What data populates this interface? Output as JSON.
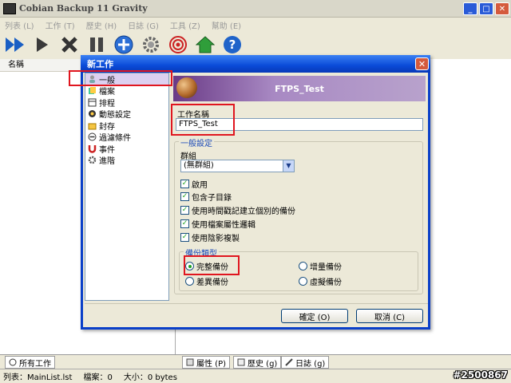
{
  "main_window": {
    "title": "Cobian Backup 11 Gravity",
    "menu": [
      "列表 (L)",
      "工作 (T)",
      "歷史 (H)",
      "日誌 (G)",
      "工具 (Z)",
      "幫助 (E)"
    ],
    "list_header": "名稱",
    "bottom_left_tab": "所有工作",
    "bottom_tabs": [
      "屬性 (P)",
      "歷史 (g)",
      "日誌 (g)"
    ],
    "status": {
      "list": "列表：MainList.lst",
      "tasks": "檔案：0",
      "size": "大小：0 bytes"
    },
    "watermark": "#2500867"
  },
  "dialog": {
    "title": "新工作",
    "nav_items": [
      "一般",
      "檔案",
      "排程",
      "動態設定",
      "封存",
      "過濾條件",
      "事件",
      "進階"
    ],
    "selected_nav": 0,
    "banner": "FTPS_Test",
    "task_name_label": "工作名稱",
    "task_name_value": "FTPS_Test",
    "general_group_title": "一般設定",
    "group_label": "群組",
    "group_value": "(無群組)",
    "checkboxes": [
      {
        "label": "啟用",
        "checked": true
      },
      {
        "label": "包含子目錄",
        "checked": true
      },
      {
        "label": "使用時間戳記建立個別的備份",
        "checked": true
      },
      {
        "label": "使用檔案屬性邏輯",
        "checked": true
      },
      {
        "label": "使用陰影複製",
        "checked": true
      }
    ],
    "backup_type_title": "備份類型",
    "backup_types": [
      "完整備份",
      "增量備份",
      "差異備份",
      "虛擬備份"
    ],
    "selected_backup_type": 0,
    "ok_label": "確定 (O)",
    "cancel_label": "取消 (C)"
  },
  "colors": {
    "highlight_box": "#e0161f",
    "dialog_title": "#0a4bd8",
    "banner": "#8a5fae"
  }
}
